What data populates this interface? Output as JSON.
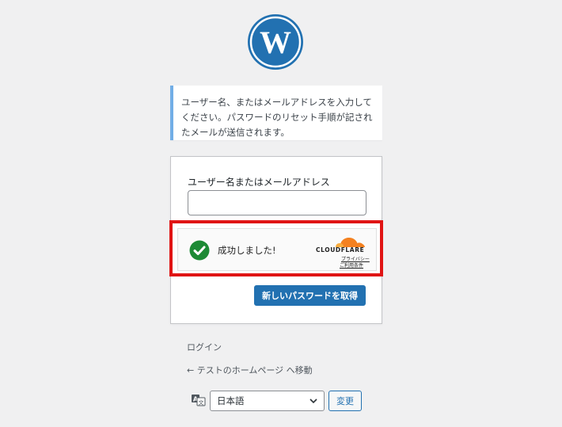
{
  "logo": {
    "icon": "wordpress-logo-icon",
    "color": "#2271b1"
  },
  "notice": {
    "text": "ユーザー名、またはメールアドレスを入力してください。パスワードのリセット手順が記されたメールが送信されます。"
  },
  "form": {
    "field_label": "ユーザー名またはメールアドレス",
    "field_value": "",
    "turnstile": {
      "status_text": "成功しました!",
      "brand": "CLOUDFLARE",
      "privacy_link": "プライバシー",
      "terms_link": "ご利用条件",
      "status_icon": "checkmark-circle-icon",
      "success_color": "#1d8a35",
      "brand_color": "#f48120"
    },
    "submit_label": "新しいパスワードを取得"
  },
  "nav": {
    "login_label": "ログイン",
    "back_label": "← テストのホームページ へ移動"
  },
  "language": {
    "icon": "translate-icon",
    "selected": "日本語",
    "change_label": "変更"
  },
  "colors": {
    "accent": "#2271b1",
    "notice_border": "#72aee6",
    "highlight": "#e01414",
    "background": "#f0f0f1"
  }
}
